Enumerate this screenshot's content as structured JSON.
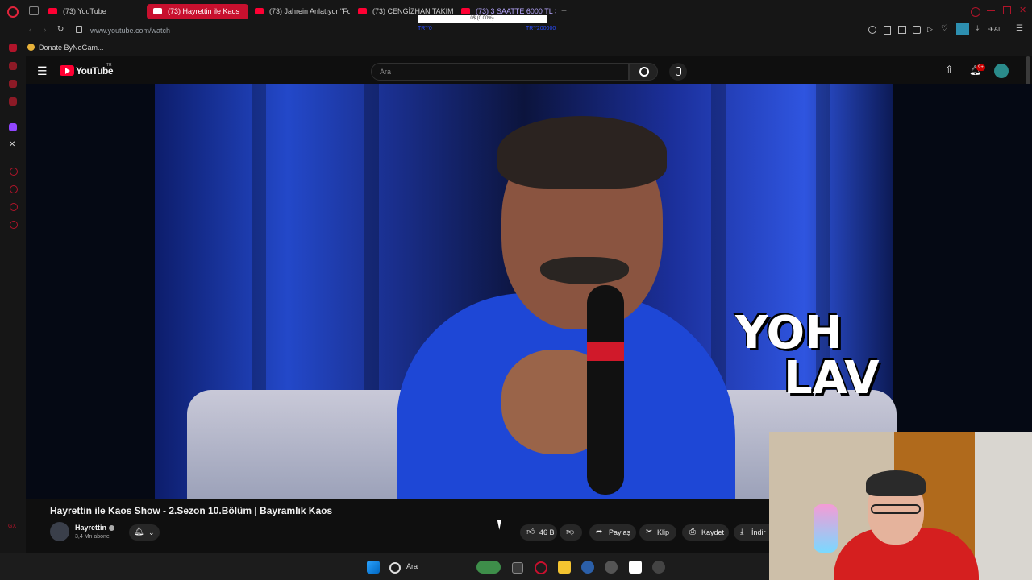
{
  "browser": {
    "tabs": [
      {
        "label": "(73) YouTube",
        "active": false
      },
      {
        "label": "(73) Hayrettin ile Kaos",
        "active": true
      },
      {
        "label": "(73) Jahrein Anlatıyor \"Fo",
        "active": false
      },
      {
        "label": "(73) CENGİZHAN TAKIM I",
        "active": false
      },
      {
        "label": "(73) 3 SAATTE 6000 TL S",
        "active": false
      }
    ],
    "tab_overlay_text": "0$ (0.00%)",
    "tab_overlay_left": "TRY0",
    "tab_overlay_right": "TRY200000",
    "url": "www.youtube.com/watch",
    "bookmark": "Donate ByNoGam..."
  },
  "youtube": {
    "logo_text": "YouTube",
    "region": "TR",
    "search_placeholder": "Ara",
    "notification_badge": "9+"
  },
  "video": {
    "overlay_line1": "YOH",
    "overlay_line2": "LAV",
    "title": "Hayrettin ile Kaos Show - 2.Sezon 10.Bölüm | Bayramlık Kaos",
    "channel": "Hayrettin",
    "subscribers": "3,4 Mn abone",
    "likes": "46 B",
    "actions": {
      "share": "Paylaş",
      "clip": "Klip",
      "save": "Kaydet",
      "download": "İndir"
    }
  },
  "taskbar": {
    "search_label": "Ara"
  },
  "colors": {
    "brand": "#ff0033",
    "active_tab": "#c8102e"
  }
}
